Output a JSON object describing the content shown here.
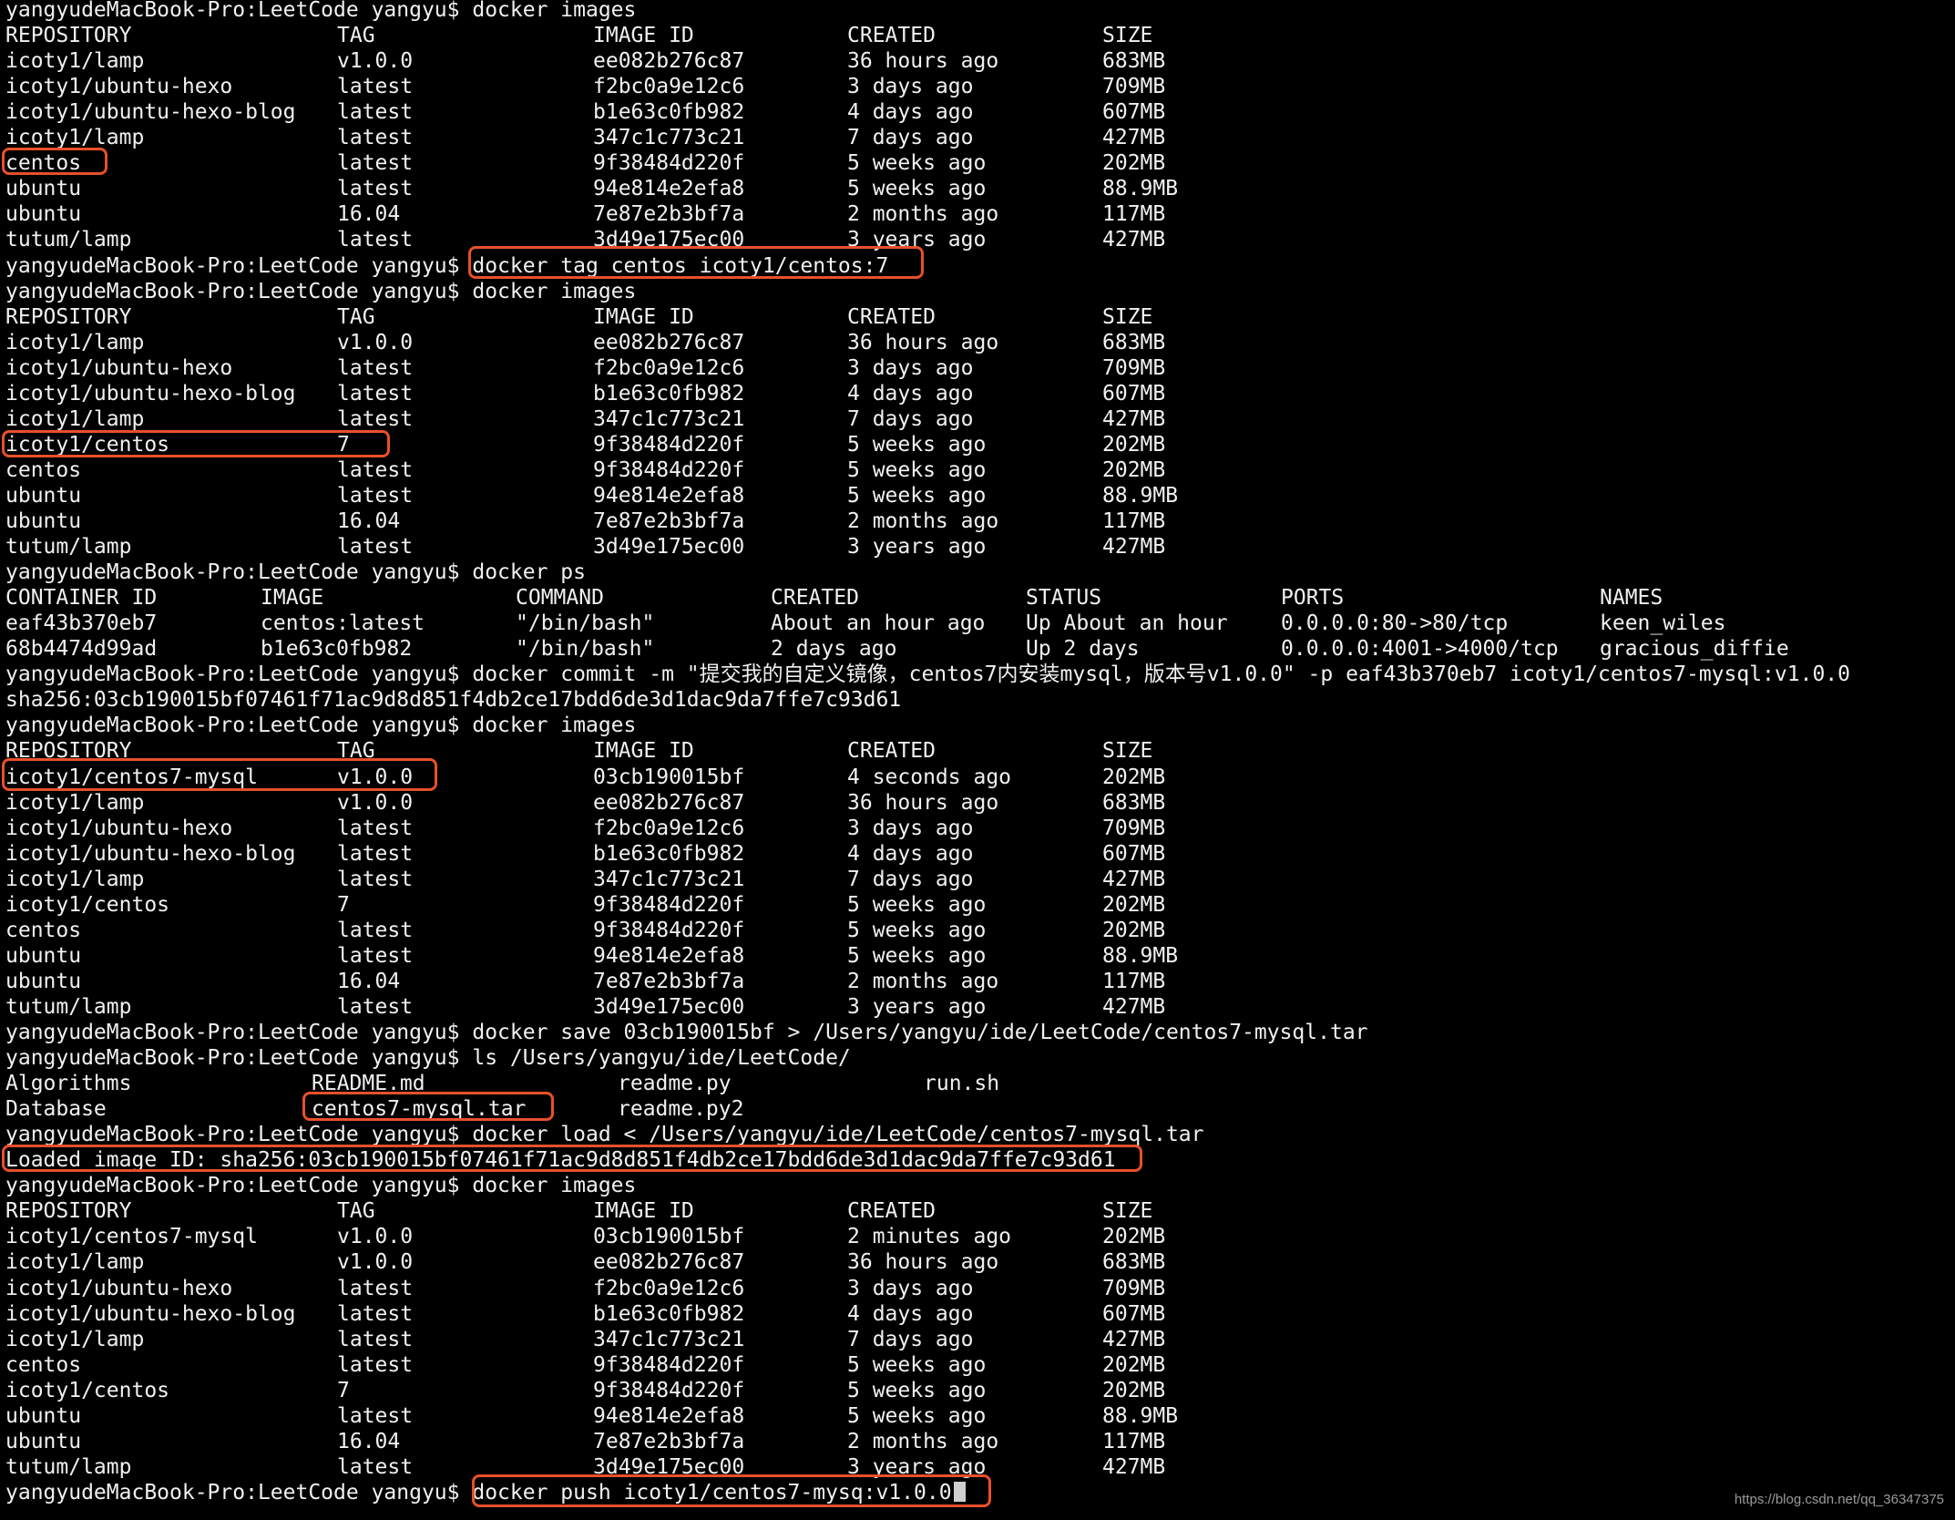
{
  "colors": {
    "background": "#000000",
    "text": "#f1f1f1",
    "highlight": "#e8502a",
    "watermark": "#9a9a9a"
  },
  "terminal": {
    "lines": [
      {
        "type": "cmd",
        "prompt": "yangyudeMacBook-Pro:LeetCode yangyu$ ",
        "text": "docker images"
      },
      {
        "type": "row",
        "cols": [
          "REPOSITORY",
          "TAG",
          "IMAGE ID",
          "CREATED",
          "SIZE"
        ]
      },
      {
        "type": "row",
        "cols": [
          "icoty1/lamp",
          "v1.0.0",
          "ee082b276c87",
          "36 hours ago",
          "683MB"
        ]
      },
      {
        "type": "row",
        "cols": [
          "icoty1/ubuntu-hexo",
          "latest",
          "f2bc0a9e12c6",
          "3 days ago",
          "709MB"
        ]
      },
      {
        "type": "row",
        "cols": [
          "icoty1/ubuntu-hexo-blog",
          "latest",
          "b1e63c0fb982",
          "4 days ago",
          "607MB"
        ]
      },
      {
        "type": "row",
        "cols": [
          "icoty1/lamp",
          "latest",
          "347c1c773c21",
          "7 days ago",
          "427MB"
        ]
      },
      {
        "type": "row",
        "cols": [
          "centos",
          "latest",
          "9f38484d220f",
          "5 weeks ago",
          "202MB"
        ]
      },
      {
        "type": "row",
        "cols": [
          "ubuntu",
          "latest",
          "94e814e2efa8",
          "5 weeks ago",
          "88.9MB"
        ]
      },
      {
        "type": "row",
        "cols": [
          "ubuntu",
          "16.04",
          "7e87e2b3bf7a",
          "2 months ago",
          "117MB"
        ]
      },
      {
        "type": "row",
        "cols": [
          "tutum/lamp",
          "latest",
          "3d49e175ec00",
          "3 years ago",
          "427MB"
        ]
      },
      {
        "type": "cmd",
        "prompt": "yangyudeMacBook-Pro:LeetCode yangyu$ ",
        "text": "docker tag centos icoty1/centos:7"
      },
      {
        "type": "cmd",
        "prompt": "yangyudeMacBook-Pro:LeetCode yangyu$ ",
        "text": "docker images"
      },
      {
        "type": "row",
        "cols": [
          "REPOSITORY",
          "TAG",
          "IMAGE ID",
          "CREATED",
          "SIZE"
        ]
      },
      {
        "type": "row",
        "cols": [
          "icoty1/lamp",
          "v1.0.0",
          "ee082b276c87",
          "36 hours ago",
          "683MB"
        ]
      },
      {
        "type": "row",
        "cols": [
          "icoty1/ubuntu-hexo",
          "latest",
          "f2bc0a9e12c6",
          "3 days ago",
          "709MB"
        ]
      },
      {
        "type": "row",
        "cols": [
          "icoty1/ubuntu-hexo-blog",
          "latest",
          "b1e63c0fb982",
          "4 days ago",
          "607MB"
        ]
      },
      {
        "type": "row",
        "cols": [
          "icoty1/lamp",
          "latest",
          "347c1c773c21",
          "7 days ago",
          "427MB"
        ]
      },
      {
        "type": "row",
        "cols": [
          "icoty1/centos",
          "7",
          "9f38484d220f",
          "5 weeks ago",
          "202MB"
        ]
      },
      {
        "type": "row",
        "cols": [
          "centos",
          "latest",
          "9f38484d220f",
          "5 weeks ago",
          "202MB"
        ]
      },
      {
        "type": "row",
        "cols": [
          "ubuntu",
          "latest",
          "94e814e2efa8",
          "5 weeks ago",
          "88.9MB"
        ]
      },
      {
        "type": "row",
        "cols": [
          "ubuntu",
          "16.04",
          "7e87e2b3bf7a",
          "2 months ago",
          "117MB"
        ]
      },
      {
        "type": "row",
        "cols": [
          "tutum/lamp",
          "latest",
          "3d49e175ec00",
          "3 years ago",
          "427MB"
        ]
      },
      {
        "type": "cmd",
        "prompt": "yangyudeMacBook-Pro:LeetCode yangyu$ ",
        "text": "docker ps"
      },
      {
        "type": "ps",
        "cols": [
          "CONTAINER ID",
          "IMAGE",
          "COMMAND",
          "CREATED",
          "STATUS",
          "PORTS",
          "NAMES"
        ]
      },
      {
        "type": "ps",
        "cols": [
          "eaf43b370eb7",
          "centos:latest",
          "\"/bin/bash\"",
          "About an hour ago",
          "Up About an hour",
          "0.0.0.0:80->80/tcp",
          "keen_wiles"
        ]
      },
      {
        "type": "ps",
        "cols": [
          "68b4474d99ad",
          "b1e63c0fb982",
          "\"/bin/bash\"",
          "2 days ago",
          "Up 2 days",
          "0.0.0.0:4001->4000/tcp",
          "gracious_diffie"
        ]
      },
      {
        "type": "cmd",
        "prompt": "yangyudeMacBook-Pro:LeetCode yangyu$ ",
        "text": "docker commit -m \"提交我的自定义镜像，centos7内安装mysql，版本号v1.0.0\" -p eaf43b370eb7 icoty1/centos7-mysql:v1.0.0"
      },
      {
        "type": "text",
        "text": "sha256:03cb190015bf07461f71ac9d8d851f4db2ce17bdd6de3d1dac9da7ffe7c93d61"
      },
      {
        "type": "cmd",
        "prompt": "yangyudeMacBook-Pro:LeetCode yangyu$ ",
        "text": "docker images"
      },
      {
        "type": "row",
        "cols": [
          "REPOSITORY",
          "TAG",
          "IMAGE ID",
          "CREATED",
          "SIZE"
        ]
      },
      {
        "type": "row",
        "cols": [
          "icoty1/centos7-mysql",
          "v1.0.0",
          "03cb190015bf",
          "4 seconds ago",
          "202MB"
        ]
      },
      {
        "type": "row",
        "cols": [
          "icoty1/lamp",
          "v1.0.0",
          "ee082b276c87",
          "36 hours ago",
          "683MB"
        ]
      },
      {
        "type": "row",
        "cols": [
          "icoty1/ubuntu-hexo",
          "latest",
          "f2bc0a9e12c6",
          "3 days ago",
          "709MB"
        ]
      },
      {
        "type": "row",
        "cols": [
          "icoty1/ubuntu-hexo-blog",
          "latest",
          "b1e63c0fb982",
          "4 days ago",
          "607MB"
        ]
      },
      {
        "type": "row",
        "cols": [
          "icoty1/lamp",
          "latest",
          "347c1c773c21",
          "7 days ago",
          "427MB"
        ]
      },
      {
        "type": "row",
        "cols": [
          "icoty1/centos",
          "7",
          "9f38484d220f",
          "5 weeks ago",
          "202MB"
        ]
      },
      {
        "type": "row",
        "cols": [
          "centos",
          "latest",
          "9f38484d220f",
          "5 weeks ago",
          "202MB"
        ]
      },
      {
        "type": "row",
        "cols": [
          "ubuntu",
          "latest",
          "94e814e2efa8",
          "5 weeks ago",
          "88.9MB"
        ]
      },
      {
        "type": "row",
        "cols": [
          "ubuntu",
          "16.04",
          "7e87e2b3bf7a",
          "2 months ago",
          "117MB"
        ]
      },
      {
        "type": "row",
        "cols": [
          "tutum/lamp",
          "latest",
          "3d49e175ec00",
          "3 years ago",
          "427MB"
        ]
      },
      {
        "type": "cmd",
        "prompt": "yangyudeMacBook-Pro:LeetCode yangyu$ ",
        "text": "docker save 03cb190015bf > /Users/yangyu/ide/LeetCode/centos7-mysql.tar"
      },
      {
        "type": "cmd",
        "prompt": "yangyudeMacBook-Pro:LeetCode yangyu$ ",
        "text": "ls /Users/yangyu/ide/LeetCode/"
      },
      {
        "type": "ls",
        "cols": [
          "Algorithms",
          "README.md",
          "readme.py",
          "run.sh"
        ]
      },
      {
        "type": "ls",
        "cols": [
          "Database",
          "centos7-mysql.tar",
          "readme.py2",
          ""
        ]
      },
      {
        "type": "cmd",
        "prompt": "yangyudeMacBook-Pro:LeetCode yangyu$ ",
        "text": "docker load < /Users/yangyu/ide/LeetCode/centos7-mysql.tar"
      },
      {
        "type": "text",
        "text": "Loaded image ID: sha256:03cb190015bf07461f71ac9d8d851f4db2ce17bdd6de3d1dac9da7ffe7c93d61"
      },
      {
        "type": "cmd",
        "prompt": "yangyudeMacBook-Pro:LeetCode yangyu$ ",
        "text": "docker images"
      },
      {
        "type": "row",
        "cols": [
          "REPOSITORY",
          "TAG",
          "IMAGE ID",
          "CREATED",
          "SIZE"
        ]
      },
      {
        "type": "row",
        "cols": [
          "icoty1/centos7-mysql",
          "v1.0.0",
          "03cb190015bf",
          "2 minutes ago",
          "202MB"
        ]
      },
      {
        "type": "row",
        "cols": [
          "icoty1/lamp",
          "v1.0.0",
          "ee082b276c87",
          "36 hours ago",
          "683MB"
        ]
      },
      {
        "type": "row",
        "cols": [
          "icoty1/ubuntu-hexo",
          "latest",
          "f2bc0a9e12c6",
          "3 days ago",
          "709MB"
        ]
      },
      {
        "type": "row",
        "cols": [
          "icoty1/ubuntu-hexo-blog",
          "latest",
          "b1e63c0fb982",
          "4 days ago",
          "607MB"
        ]
      },
      {
        "type": "row",
        "cols": [
          "icoty1/lamp",
          "latest",
          "347c1c773c21",
          "7 days ago",
          "427MB"
        ]
      },
      {
        "type": "row",
        "cols": [
          "centos",
          "latest",
          "9f38484d220f",
          "5 weeks ago",
          "202MB"
        ]
      },
      {
        "type": "row",
        "cols": [
          "icoty1/centos",
          "7",
          "9f38484d220f",
          "5 weeks ago",
          "202MB"
        ]
      },
      {
        "type": "row",
        "cols": [
          "ubuntu",
          "latest",
          "94e814e2efa8",
          "5 weeks ago",
          "88.9MB"
        ]
      },
      {
        "type": "row",
        "cols": [
          "ubuntu",
          "16.04",
          "7e87e2b3bf7a",
          "2 months ago",
          "117MB"
        ]
      },
      {
        "type": "row",
        "cols": [
          "tutum/lamp",
          "latest",
          "3d49e175ec00",
          "3 years ago",
          "427MB"
        ]
      },
      {
        "type": "cmd",
        "prompt": "yangyudeMacBook-Pro:LeetCode yangyu$ ",
        "text": "docker push icoty1/centos7-mysq:v1.0.0",
        "cursor": true
      }
    ]
  },
  "watermark": "https://blog.csdn.net/qq_36347375"
}
